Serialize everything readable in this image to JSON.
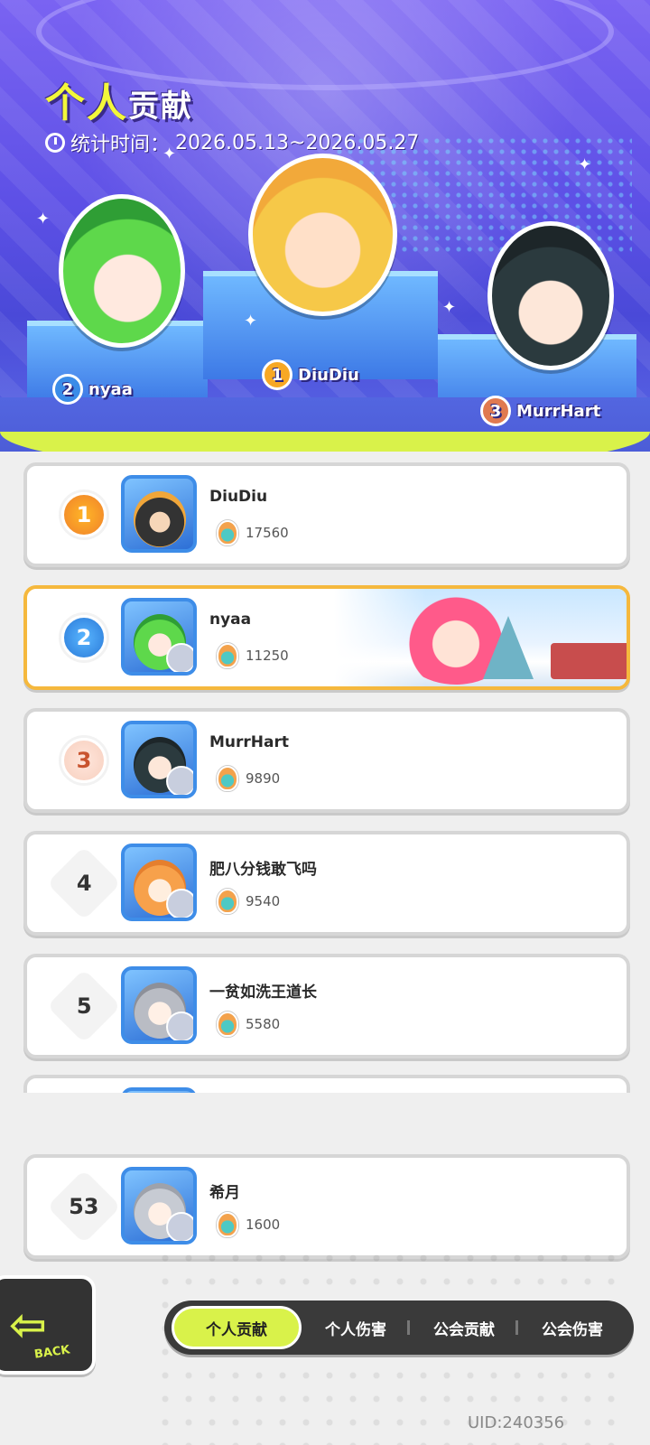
{
  "header": {
    "title_main": "个人",
    "title_sub": "贡献",
    "stat_label": "统计时间：",
    "stat_range": "2026.05.13~2026.05.27"
  },
  "podium": [
    {
      "rank": "1",
      "name": "DiuDiu"
    },
    {
      "rank": "2",
      "name": "nyaa"
    },
    {
      "rank": "3",
      "name": "MurrHart"
    }
  ],
  "rows": [
    {
      "rank": "1",
      "name": "DiuDiu",
      "score": "17560"
    },
    {
      "rank": "2",
      "name": "nyaa",
      "score": "11250"
    },
    {
      "rank": "3",
      "name": "MurrHart",
      "score": "9890"
    },
    {
      "rank": "4",
      "name": "肥八分钱敢飞吗",
      "score": "9540"
    },
    {
      "rank": "5",
      "name": "一贫如洗王道长",
      "score": "5580"
    }
  ],
  "self_row": {
    "rank": "53",
    "name": "希月",
    "score": "1600"
  },
  "back_label": "BACK",
  "tabs": [
    "个人贡献",
    "个人伤害",
    "公会贡献",
    "公会伤害"
  ],
  "active_tab": "个人贡献",
  "uid": "UID:240356",
  "colors": {
    "accent_lime": "#d9f24a",
    "header_purple": "#5d50e6",
    "highlight_border": "#f5b83d"
  }
}
